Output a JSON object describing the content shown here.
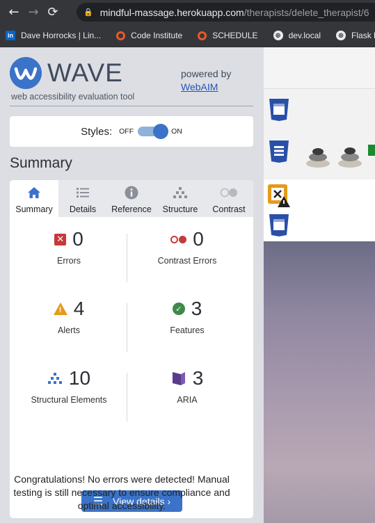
{
  "browser": {
    "url_host": "mindful-massage.herokuapp.com",
    "url_path": "/therapists/delete_therapist/6",
    "bookmarks": [
      {
        "icon": "linkedin-icon",
        "label": "Dave Horrocks | Lin..."
      },
      {
        "icon": "code-institute-icon",
        "label": "Code Institute"
      },
      {
        "icon": "schedule-icon",
        "label": "SCHEDULE"
      },
      {
        "icon": "globe-icon",
        "label": "dev.local"
      },
      {
        "icon": "globe-icon",
        "label": "Flask Loca"
      }
    ]
  },
  "wave": {
    "title": "WAVE",
    "tagline": "web accessibility evaluation tool",
    "powered_by": "powered by",
    "webaim": "WebAIM",
    "styles_label": "Styles:",
    "off": "OFF",
    "on": "ON",
    "styles_on": true,
    "summary_heading": "Summary",
    "tabs": [
      {
        "label": "Summary",
        "icon": "home-icon",
        "active": true
      },
      {
        "label": "Details",
        "icon": "list-icon",
        "active": false
      },
      {
        "label": "Reference",
        "icon": "info-icon",
        "active": false
      },
      {
        "label": "Structure",
        "icon": "hierarchy-icon",
        "active": false
      },
      {
        "label": "Contrast",
        "icon": "contrast-icon",
        "active": false
      }
    ],
    "stats": {
      "errors": {
        "count": "0",
        "label": "Errors"
      },
      "contrast": {
        "count": "0",
        "label": "Contrast Errors"
      },
      "alerts": {
        "count": "4",
        "label": "Alerts"
      },
      "features": {
        "count": "3",
        "label": "Features"
      },
      "structural": {
        "count": "10",
        "label": "Structural Elements"
      },
      "aria": {
        "count": "3",
        "label": "ARIA"
      }
    },
    "view_details": "View details ›",
    "message": "Congratulations! No errors were detected! Manual testing is still necessary to ensure compliance and optimal accessibility.",
    "colors": {
      "accent": "#3b73c8",
      "error": "#c8393b",
      "alert": "#e49a1b",
      "feature": "#3f8a4a",
      "aria": "#5b3a8e"
    }
  }
}
